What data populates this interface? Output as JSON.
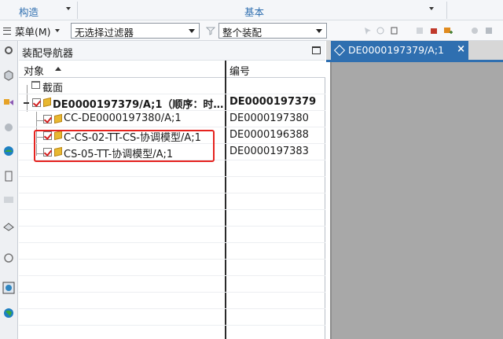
{
  "ribbon": {
    "groups": [
      "构造",
      "基本"
    ]
  },
  "toolbar": {
    "menu_label": "菜单(M)",
    "filter_value": "无选择过滤器",
    "scope_value": "整个装配"
  },
  "navigator": {
    "title": "装配导航器",
    "columns": [
      "对象",
      "编号"
    ],
    "sort": "ascending",
    "rows": [
      {
        "name": "截面",
        "number": "",
        "checked": false
      },
      {
        "name": "DE0000197379/A;1（顺序：时…",
        "number": "DE0000197379",
        "checked": true,
        "bold": true
      },
      {
        "name": "CC-DE0000197380/A;1",
        "number": "DE0000197380",
        "checked": true
      },
      {
        "name": "C-CS-02-TT-CS-协调模型/A;1",
        "number": "DE0000196388",
        "checked": true
      },
      {
        "name": "CS-05-TT-协调模型/A;1",
        "number": "DE0000197383",
        "checked": true
      }
    ]
  },
  "document_tab": {
    "label": "DE0000197379/A;1",
    "close": "×"
  },
  "colors": {
    "accent": "#2f6fb0",
    "highlight_border": "#e5231f",
    "canvas_bg": "#a8a8a8"
  }
}
